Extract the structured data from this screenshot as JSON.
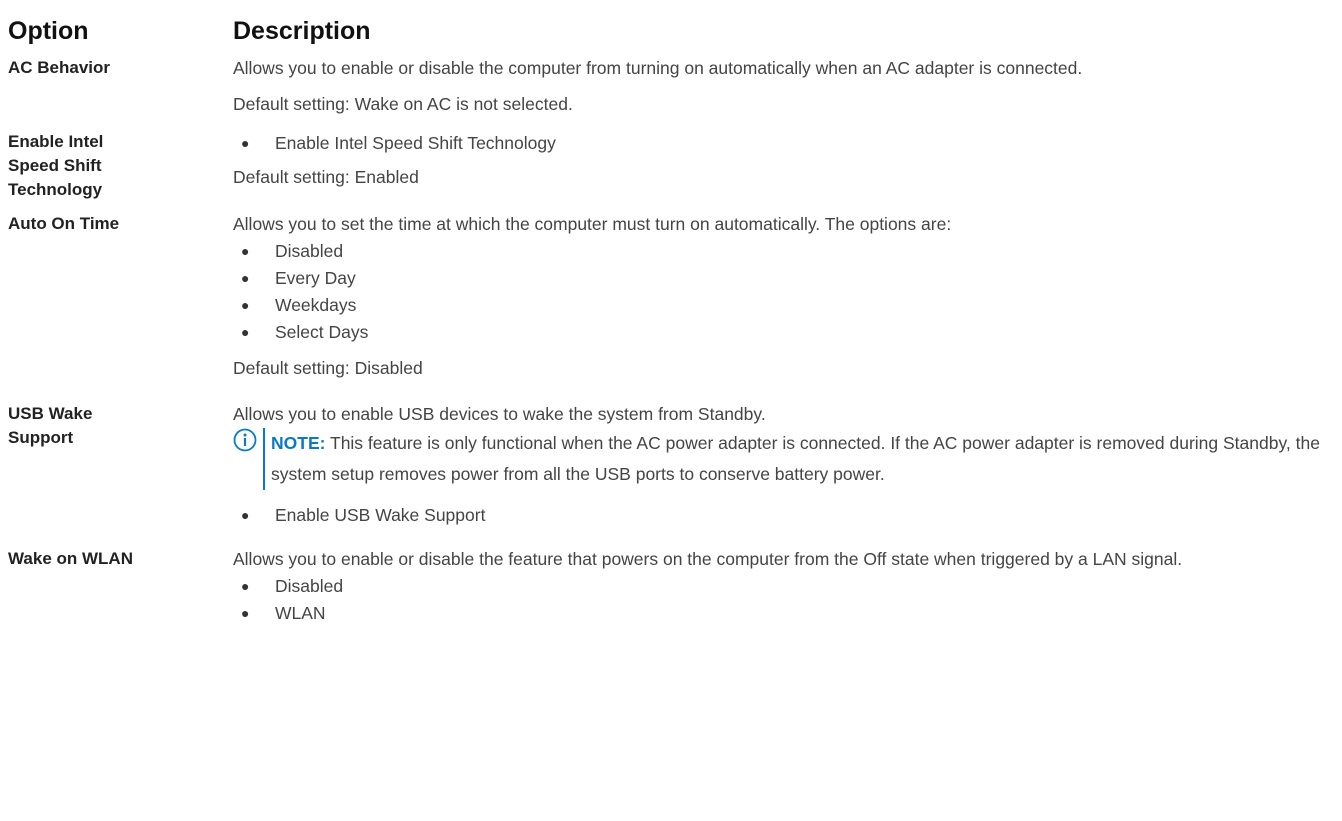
{
  "header": {
    "option": "Option",
    "description": "Description"
  },
  "rows": {
    "ac_behavior": {
      "label": "AC Behavior",
      "desc": "Allows you to enable or disable the computer from turning on automatically when an AC adapter is connected.",
      "default": "Default setting: Wake on AC is not selected."
    },
    "speed_shift": {
      "label_lines": [
        "Enable Intel",
        "Speed Shift",
        "Technology"
      ],
      "bullet": "Enable Intel Speed Shift Technology",
      "default": "Default setting: Enabled"
    },
    "auto_on": {
      "label": "Auto On Time",
      "desc": "Allows you to set the time at which the computer must turn on automatically. The options are:",
      "options": [
        "Disabled",
        "Every Day",
        "Weekdays",
        "Select Days"
      ],
      "default": "Default setting: Disabled"
    },
    "usb_wake": {
      "label_lines": [
        "USB Wake",
        "Support"
      ],
      "desc": "Allows you to enable USB devices to wake the system from Standby.",
      "note_label": "NOTE:",
      "note_text": "This feature is only functional when the AC power adapter is connected. If the AC power adapter is removed during Standby, the system setup removes power from all the USB ports to conserve battery power.",
      "bullet": "Enable USB Wake Support"
    },
    "wake_wlan": {
      "label": "Wake on WLAN",
      "desc": "Allows you to enable or disable the feature that powers on the computer from the Off state when triggered by a LAN signal.",
      "options": [
        "Disabled",
        "WLAN"
      ]
    }
  },
  "colors": {
    "accent": "#0a7ac4",
    "text": "#444444",
    "heading": "#111111"
  },
  "icons": {
    "note": "info-icon"
  }
}
